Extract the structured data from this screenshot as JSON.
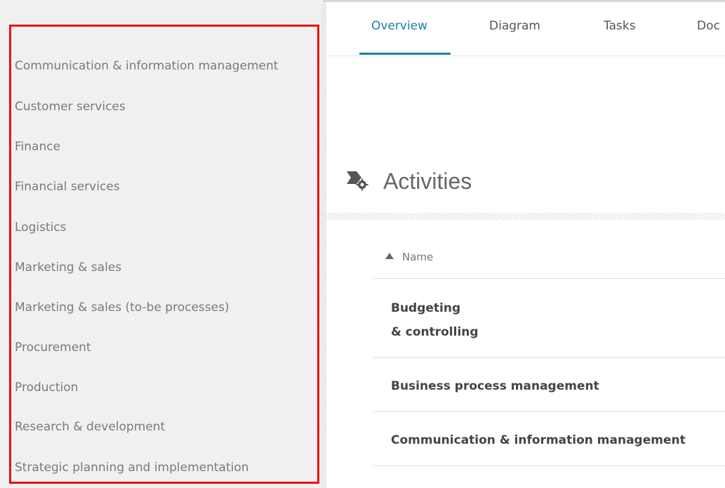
{
  "sidebar": {
    "items": [
      {
        "label": "Communication & information management"
      },
      {
        "label": "Customer services"
      },
      {
        "label": "Finance"
      },
      {
        "label": "Financial services"
      },
      {
        "label": "Logistics"
      },
      {
        "label": "Marketing & sales"
      },
      {
        "label": "Marketing & sales (to-be processes)"
      },
      {
        "label": "Procurement"
      },
      {
        "label": "Production"
      },
      {
        "label": "Research & development"
      },
      {
        "label": "Strategic planning and implementation"
      }
    ]
  },
  "tabs": [
    {
      "label": "Overview",
      "active": true
    },
    {
      "label": "Diagram"
    },
    {
      "label": "Tasks"
    },
    {
      "label": "Doc"
    }
  ],
  "activities": {
    "title": "Activities",
    "icon": "activities-gear-icon",
    "column_header": "Name",
    "sort": "ascending",
    "rows": [
      {
        "line1": "Budgeting",
        "line2": "& controlling"
      },
      {
        "name": "Business process management"
      },
      {
        "name": "Communication & information management"
      }
    ]
  },
  "colors": {
    "accent": "#1d7fa6",
    "highlight": "#ee1111"
  }
}
